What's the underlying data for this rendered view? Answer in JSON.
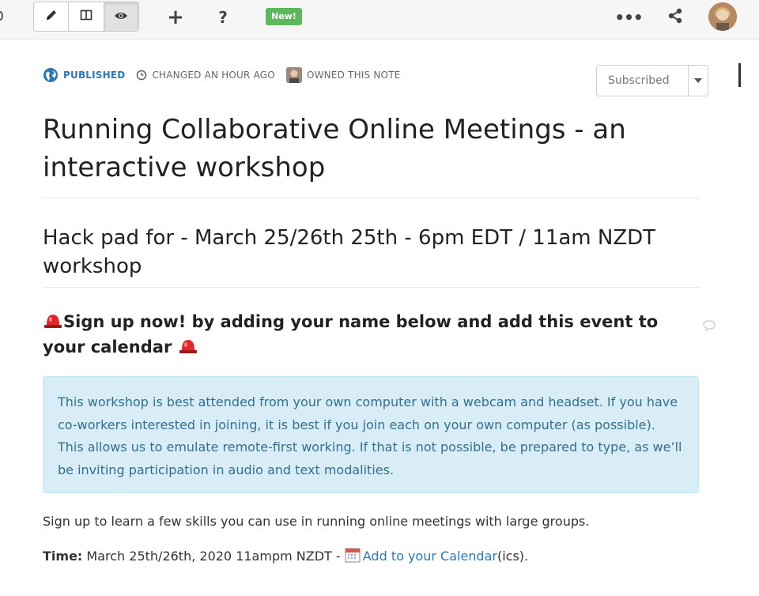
{
  "toolbar": {
    "new_badge": "New!",
    "help_label": "?",
    "plus_label": "+",
    "more_label": "•••",
    "modes": [
      "edit",
      "split",
      "view"
    ],
    "active_mode": "view"
  },
  "meta": {
    "published": "PUBLISHED",
    "changed": "CHANGED AN HOUR AGO",
    "owned": "OWNED THIS NOTE"
  },
  "subscribe": {
    "label": "Subscribed"
  },
  "note": {
    "title": "Running Collaborative Online Meetings - an interactive workshop",
    "subtitle": "Hack pad for - March 25/26th 25th - 6pm EDT / 11am NZDT workshop",
    "signup_heading": "Sign up now! by adding your name below and add this event to your calendar",
    "alert_text": "This workshop is best attended from your own computer with a webcam and headset. If you have co-workers interested in joining, it is best if you join each on your own computer (as possible). This allows us to emulate remote-first working. If that is not possible, be prepared to type, as we’ll be inviting participation in audio and text modalities.",
    "body_text": "Sign up to learn a few skills you can use in running online meetings with large groups.",
    "time_label": "Time:",
    "time_value": "March 25th/26th, 2020 11ampm NZDT -",
    "calendar_link": "Add to your Calendar",
    "calendar_suffix": "(ics)."
  },
  "colors": {
    "accent": "#2a7ab8",
    "new_badge": "#5cb85c",
    "alert_bg": "#d9edf7",
    "alert_text": "#31708f"
  },
  "icons": [
    "pencil-icon",
    "split-view-icon",
    "eye-icon",
    "plus-icon",
    "help-icon",
    "more-icon",
    "share-icon",
    "globe-icon",
    "clock-icon",
    "siren-icon",
    "comment-icon",
    "calendar-icon",
    "caret-down-icon"
  ]
}
